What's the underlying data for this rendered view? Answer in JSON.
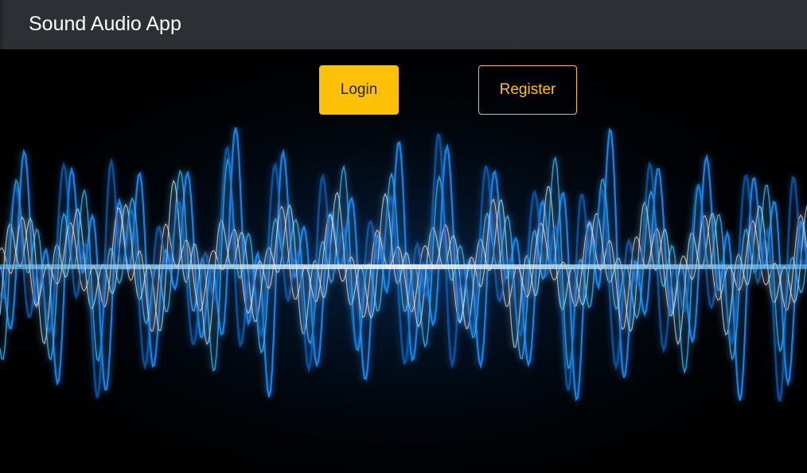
{
  "navbar": {
    "brand": "Sound Audio App"
  },
  "hero": {
    "background_image": "blue-sound-wave",
    "login_label": "Login",
    "register_label": "Register"
  },
  "colors": {
    "navbar_bg": "#2c3034",
    "accent": "#ffc107",
    "wave": "#1e90ff",
    "background": "#000000"
  }
}
